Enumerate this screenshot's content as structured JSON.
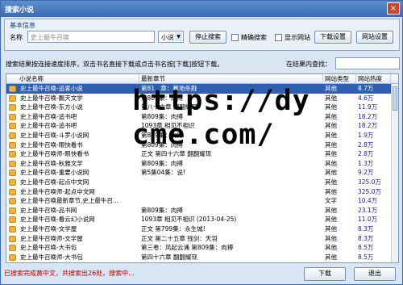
{
  "window": {
    "title": "搜索小说",
    "close_symbol": "×"
  },
  "group": {
    "title": "基本信息",
    "name_label": "名称",
    "name_value": "史上最牛召唤",
    "select_value": "小说",
    "stop_btn": "停止搜索",
    "exact_label": "精确搜索",
    "show_site_label": "显示网站",
    "download_settings_btn": "下载设置",
    "site_settings_btn": "网站设置"
  },
  "hint": "搜索结果按连接速度排序，双击书名直接下载或点击书名按[下载]按钮下载。",
  "filter_label": "在结果内查找：",
  "columns": {
    "name": "小说名称",
    "chapter": "最新章节",
    "type": "网站类型",
    "heat": "网站热度"
  },
  "rows": [
    {
      "name": "史上最牛召唤-追客小说",
      "chapter": "第81...章：暮地杀戮",
      "type": "其他",
      "heat": "8.7万"
    },
    {
      "name": "史上最牛召唤-飘天文学",
      "chapter": "第809集：肉搏",
      "type": "其他",
      "heat": "4.6万"
    },
    {
      "name": "史上最牛召唤-东方小说",
      "chapter": "第八十六章 翻翻耀现",
      "type": "其他",
      "heat": "11.9万"
    },
    {
      "name": "史上最牛召唤-追书吧",
      "chapter": "第809集：肉搏",
      "type": "其他",
      "heat": "18.2万"
    },
    {
      "name": "史上最牛召唤-追书吧",
      "chapter": "1093章 相见不相识",
      "type": "其他",
      "heat": "18.2万"
    },
    {
      "name": "史上最牛召唤-斗罗小说网",
      "chapter": "第809集：肉搏",
      "type": "其他",
      "heat": "1.9万"
    },
    {
      "name": "史上最牛召唤-眼快看书",
      "chapter": "第809集：肉搏",
      "type": "其他",
      "heat": "2.8万"
    },
    {
      "name": "史上最牛召唤师-眼快看书",
      "chapter": "正文 第四十六章 翻翻耀现",
      "type": "其他",
      "heat": "2.8万"
    },
    {
      "name": "史上最牛召唤-秋雅文学",
      "chapter": "第809集：肉搏",
      "type": "其他",
      "heat": "1.3万"
    },
    {
      "name": "史上最牛召唤-重要小说网",
      "chapter": "第5集04集：说!",
      "type": "其他",
      "heat": "9.2万"
    },
    {
      "name": "史上最牛召唤-起点中文网",
      "chapter": "",
      "type": "其他",
      "heat": "325.0万"
    },
    {
      "name": "史上最牛召唤师-起点中文网",
      "chapter": "",
      "type": "其他",
      "heat": "325.0万"
    },
    {
      "name": "史上最牛召唤最新章节,史上最牛召...",
      "chapter": "",
      "type": "文字",
      "heat": "10.4万"
    },
    {
      "name": "史上最牛召唤-品书网",
      "chapter": "第809集：肉搏",
      "type": "其他",
      "heat": "23.1万"
    },
    {
      "name": "史上最牛召唤-看云幻小说网",
      "chapter": "1093章 相见不相识 (2013-04-25)",
      "type": "其他",
      "heat": "11.0万"
    },
    {
      "name": "史上最牛召唤-文学屋",
      "chapter": "正文 第799集：永生城!",
      "type": "其他",
      "heat": "8.3万"
    },
    {
      "name": "史上最牛召唤师-文学屋",
      "chapter": "正文 第二十五章 残剑：天羽",
      "type": "其他",
      "heat": "8.3万"
    },
    {
      "name": "史上最牛召唤-大书包",
      "chapter": "第三卷：风起云涌 第809集：肉搏",
      "type": "其他",
      "heat": "8.5万"
    },
    {
      "name": "史上最牛召唤师-大书包",
      "chapter": "第四十六章 翻翻耀现",
      "type": "其他",
      "heat": "8.5万"
    }
  ],
  "status": "已搜索完成黄中文，共搜索出26处，搜索中...",
  "download_btn": "下载",
  "exit_btn": "退出",
  "watermark": {
    "line1": "https://dy",
    "line2": "cme.com/"
  }
}
